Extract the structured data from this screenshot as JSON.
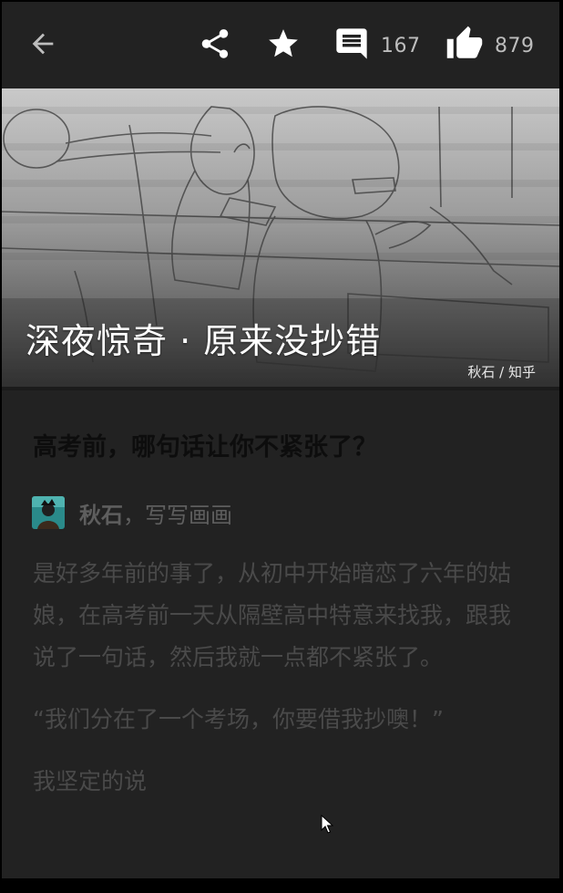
{
  "toolbar": {
    "comment_count": "167",
    "like_count": "879"
  },
  "hero": {
    "title": "深夜惊奇 · 原来没抄错",
    "credit": "秋石 / 知乎"
  },
  "question": {
    "title": "高考前，哪句话让你不紧张了？"
  },
  "author": {
    "name": "秋石",
    "bio": "，写写画画"
  },
  "article": {
    "paragraphs": [
      "是好多年前的事了，从初中开始暗恋了六年的姑娘，在高考前一天从隔壁高中特意来找我，跟我说了一句话，然后我就一点都不紧张了。",
      "“我们分在了一个考场，你要借我抄噢！”",
      "我坚定的说"
    ]
  },
  "icons": {
    "back": "arrow-left-icon",
    "share": "share-icon",
    "favorite": "star-icon",
    "comment": "comment-icon",
    "like": "thumbs-up-icon"
  },
  "colors": {
    "background": "#222222",
    "icon": "#ffffff",
    "count_text": "#bdbdbd",
    "question_text": "#0d0d0d",
    "author_text": "#5e5e5e",
    "body_text": "#4a4a4a"
  }
}
